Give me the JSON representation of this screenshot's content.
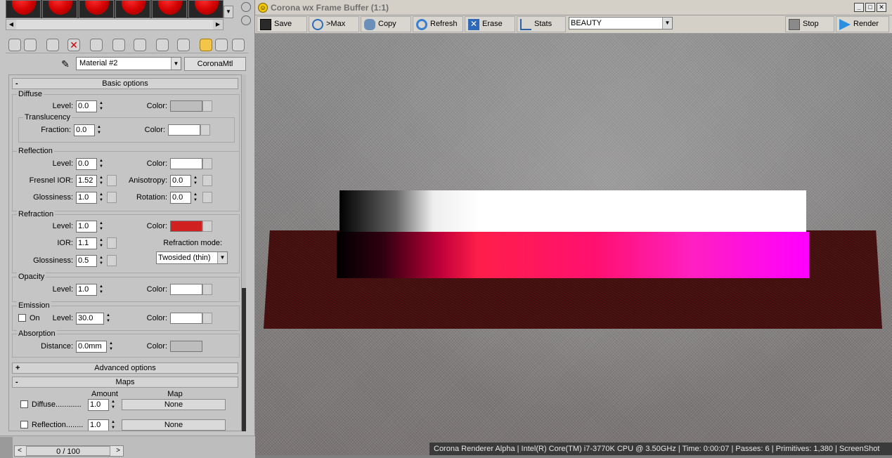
{
  "material_editor": {
    "material_name": "Material #2",
    "material_type": "CoronaMtl",
    "basic_options": {
      "header": "Basic options",
      "diffuse": {
        "title": "Diffuse",
        "level_label": "Level:",
        "level": "0.0",
        "color_label": "Color:",
        "color": "#bdbdbd"
      },
      "translucency": {
        "title": "Translucency",
        "fraction_label": "Fraction:",
        "fraction": "0.0",
        "color_label": "Color:",
        "color": "#ffffff"
      },
      "reflection": {
        "title": "Reflection",
        "level_label": "Level:",
        "level": "0.0",
        "color_label": "Color:",
        "color": "#ffffff",
        "fresnel_label": "Fresnel IOR:",
        "fresnel_ior": "1.52",
        "aniso_label": "Anisotropy:",
        "anisotropy": "0.0",
        "gloss_label": "Glossiness:",
        "glossiness": "1.0",
        "rotation_label": "Rotation:",
        "rotation": "0.0"
      },
      "refraction": {
        "title": "Refraction",
        "level_label": "Level:",
        "level": "1.0",
        "color_label": "Color:",
        "color": "#d02020",
        "ior_label": "IOR:",
        "ior": "1.1",
        "gloss_label": "Glossiness:",
        "glossiness": "0.5",
        "mode_label": "Refraction mode:",
        "mode": "Twosided (thin)"
      },
      "opacity": {
        "title": "Opacity",
        "level_label": "Level:",
        "level": "1.0",
        "color_label": "Color:",
        "color": "#ffffff"
      },
      "emission": {
        "title": "Emission",
        "on_label": "On",
        "level_label": "Level:",
        "level": "30.0",
        "color_label": "Color:",
        "color": "#ffffff"
      },
      "absorption": {
        "title": "Absorption",
        "distance_label": "Distance:",
        "distance": "0.0mm",
        "color_label": "Color:",
        "color": "#bdbdbd"
      }
    },
    "advanced_options": {
      "header": "Advanced options"
    },
    "maps": {
      "header": "Maps",
      "amount_header": "Amount",
      "map_header": "Map",
      "rows": [
        {
          "label": "Diffuse............",
          "amount": "1.0",
          "map": "None"
        },
        {
          "label": "Reflection........",
          "amount": "1.0",
          "map": "None"
        }
      ]
    },
    "timeline": {
      "label": "0 / 100",
      "prev": "<",
      "next": ">"
    }
  },
  "frame_buffer": {
    "title": "Corona wx Frame Buffer (1:1)",
    "buttons": {
      "save": "Save",
      "max": ">Max",
      "copy": "Copy",
      "refresh": "Refresh",
      "erase": "Erase",
      "stats": "Stats",
      "stop": "Stop",
      "render": "Render"
    },
    "channel": "BEAUTY",
    "status": "Corona Renderer Alpha | Intel(R) Core(TM) i7-3770K CPU @ 3.50GHz | Time: 0:00:07 | Passes: 6 | Primitives: 1,380 | ScreenShot",
    "watermark": "ScreenShot"
  },
  "colors": {
    "accent_active_tool": "#f3c64a",
    "slot_ball": "#d00000"
  }
}
